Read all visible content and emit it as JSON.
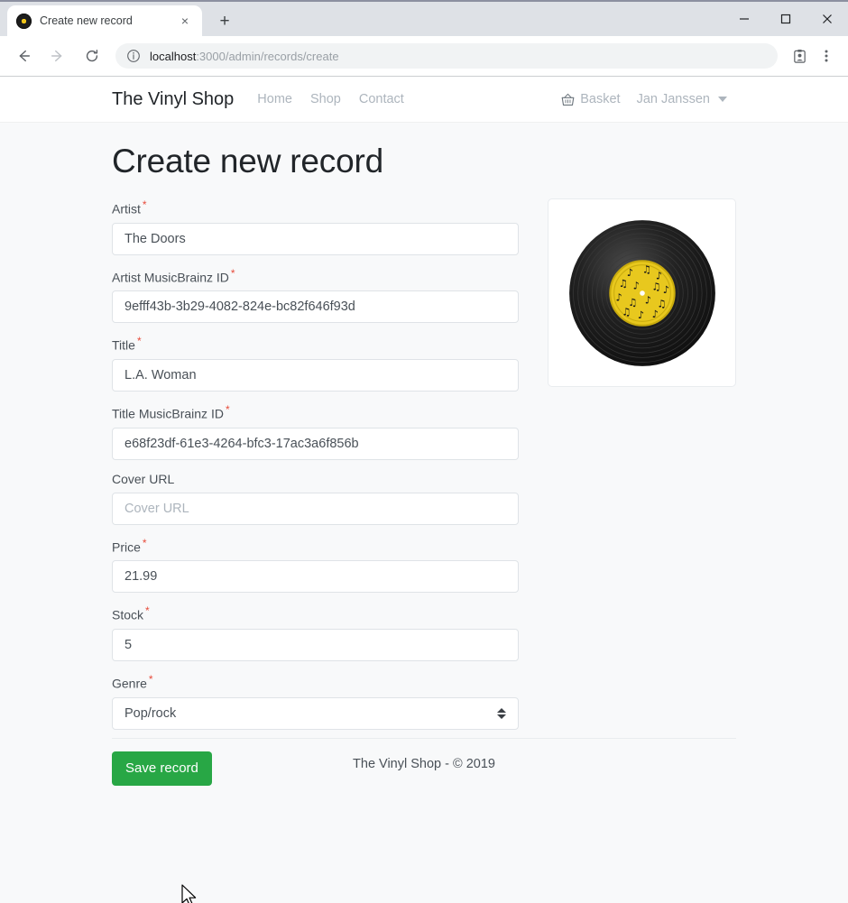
{
  "browser": {
    "tab": {
      "title": "Create new record",
      "favicon": "vinyl-record-icon",
      "close": "×"
    },
    "new_tab": "+",
    "window_controls": {
      "minimize": "minimize-icon",
      "maximize": "maximize-icon",
      "close": "close-icon"
    },
    "nav": {
      "back": "back-arrow-icon",
      "forward": "forward-arrow-icon",
      "reload": "reload-icon"
    },
    "address": {
      "info_icon": "info-icon",
      "host": "localhost",
      "path": ":3000/admin/records/create"
    },
    "toolbar_icons": {
      "profile": "profile-badge-icon",
      "menu": "three-dot-menu-icon"
    }
  },
  "site": {
    "brand": "The Vinyl Shop",
    "nav_links": [
      {
        "label": "Home"
      },
      {
        "label": "Shop"
      },
      {
        "label": "Contact"
      }
    ],
    "basket": {
      "icon": "basket-icon",
      "label": "Basket"
    },
    "user": {
      "name": "Jan Janssen",
      "caret": "chevron-down-icon"
    }
  },
  "page": {
    "title": "Create new record",
    "required_marker": "*"
  },
  "form": {
    "fields": [
      {
        "label": "Artist",
        "required": true,
        "value": "The Doors",
        "is_placeholder": false,
        "type": "text"
      },
      {
        "label": "Artist MusicBrainz ID",
        "required": true,
        "value": "9efff43b-3b29-4082-824e-bc82f646f93d",
        "is_placeholder": false,
        "type": "text"
      },
      {
        "label": "Title",
        "required": true,
        "value": "L.A. Woman",
        "is_placeholder": false,
        "type": "text"
      },
      {
        "label": "Title MusicBrainz ID",
        "required": true,
        "value": "e68f23df-61e3-4264-bfc3-17ac3a6f856b",
        "is_placeholder": false,
        "type": "text"
      },
      {
        "label": "Cover URL",
        "required": false,
        "value": "Cover URL",
        "is_placeholder": true,
        "type": "text"
      },
      {
        "label": "Price",
        "required": true,
        "value": "21.99",
        "is_placeholder": false,
        "type": "text"
      },
      {
        "label": "Stock",
        "required": true,
        "value": "5",
        "is_placeholder": false,
        "type": "text"
      },
      {
        "label": "Genre",
        "required": true,
        "value": "Pop/rock",
        "is_placeholder": false,
        "type": "select"
      }
    ],
    "submit_label": "Save record",
    "submit_color": "#28a745"
  },
  "preview": {
    "image_name": "vinyl-record-image",
    "disc_color": "#1a1a1a",
    "label_color": "#e8c81e"
  },
  "footer": {
    "text": "The Vinyl Shop - © 2019"
  }
}
